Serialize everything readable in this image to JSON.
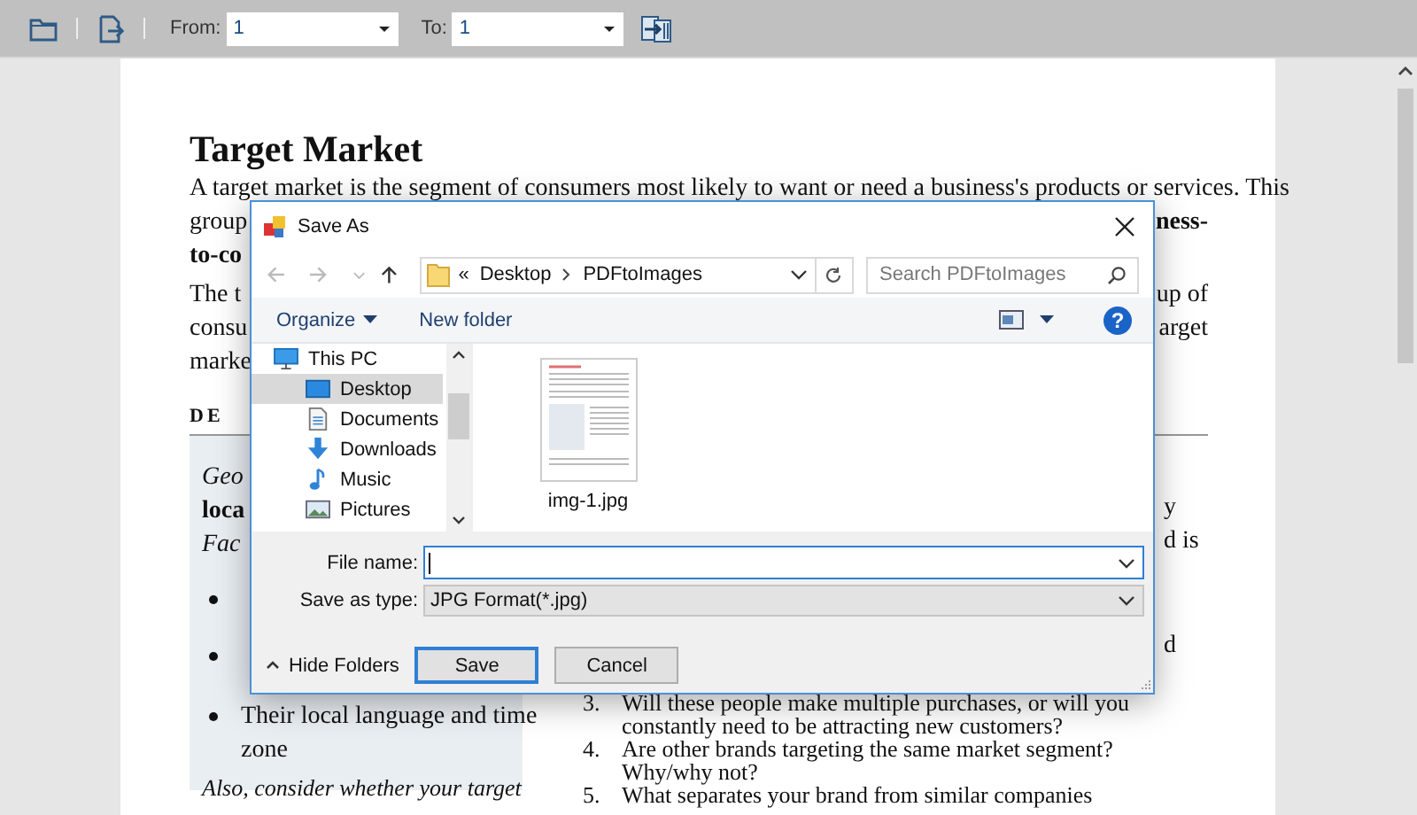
{
  "toolbar": {
    "from_label": "From:",
    "from_value": "1",
    "to_label": "To:",
    "to_value": "1"
  },
  "document": {
    "title": "Target Market",
    "paragraphs": [
      [
        [
          {
            "text": "A target market is the segment of consumers most likely to want or need a business's products or services. This",
            "kind": "plain"
          }
        ],
        [
          {
            "text": "group",
            "kind": "plain"
          },
          {
            "text": "ness-",
            "kind": "bold"
          }
        ],
        [
          {
            "text": "to-co",
            "kind": "bold"
          }
        ]
      ],
      [
        [
          {
            "text": "The t",
            "kind": "plain"
          },
          {
            "text": "up of",
            "kind": "plain"
          }
        ],
        [
          {
            "text": "consu",
            "kind": "plain"
          },
          {
            "text": "arget",
            "kind": "plain"
          }
        ],
        [
          {
            "text": "marke",
            "kind": "plain"
          }
        ]
      ]
    ],
    "table": {
      "header": "DE",
      "left_column": {
        "lines": [
          {
            "text": "Geo",
            "kind": "italic"
          },
          {
            "text": "loca",
            "kind": "bold"
          },
          {
            "text": "Fac",
            "kind": "italic"
          }
        ],
        "bullets": [
          {
            "kind": "marker"
          },
          {
            "kind": "marker"
          },
          {
            "kind": "text",
            "lines": [
              "Their local language and time",
              "zone"
            ]
          }
        ],
        "note": "Also, consider whether your target"
      },
      "right_column": {
        "fragments": [
          "y",
          "d is",
          "d"
        ],
        "items": [
          {
            "number": "3.",
            "lines": [
              "Will these people make multiple purchases, or will you",
              "constantly need to be attracting new customers?"
            ]
          },
          {
            "number": "4.",
            "lines": [
              "Are other brands targeting the same market segment?",
              "Why/why not?"
            ]
          },
          {
            "number": "5.",
            "lines": [
              "What separates your brand from similar companies"
            ]
          }
        ]
      }
    }
  },
  "dialog": {
    "title": "Save As",
    "address": {
      "prefix": "«",
      "path": [
        "Desktop",
        "PDFtoImages"
      ]
    },
    "search": {
      "placeholder": "Search PDFtoImages"
    },
    "commands": {
      "organize": "Organize",
      "new_folder": "New folder",
      "help": "?"
    },
    "tree": [
      {
        "label": "This PC",
        "kind": "computer",
        "selected": false,
        "children": [
          {
            "label": "Desktop",
            "kind": "desktop",
            "selected": true
          },
          {
            "label": "Documents",
            "kind": "documents",
            "selected": false
          },
          {
            "label": "Downloads",
            "kind": "downloads",
            "selected": false
          },
          {
            "label": "Music",
            "kind": "music",
            "selected": false
          },
          {
            "label": "Pictures",
            "kind": "pictures",
            "selected": false
          }
        ]
      }
    ],
    "files": [
      {
        "name": "img-1.jpg"
      }
    ],
    "file_name": {
      "label": "File name:",
      "focused": true
    },
    "file_type": {
      "label": "Save as type:",
      "value": "JPG Format(*.jpg)"
    },
    "hide_folders": "Hide Folders",
    "buttons": [
      {
        "label": "Save",
        "default": true
      },
      {
        "label": "Cancel",
        "default": false
      }
    ]
  }
}
